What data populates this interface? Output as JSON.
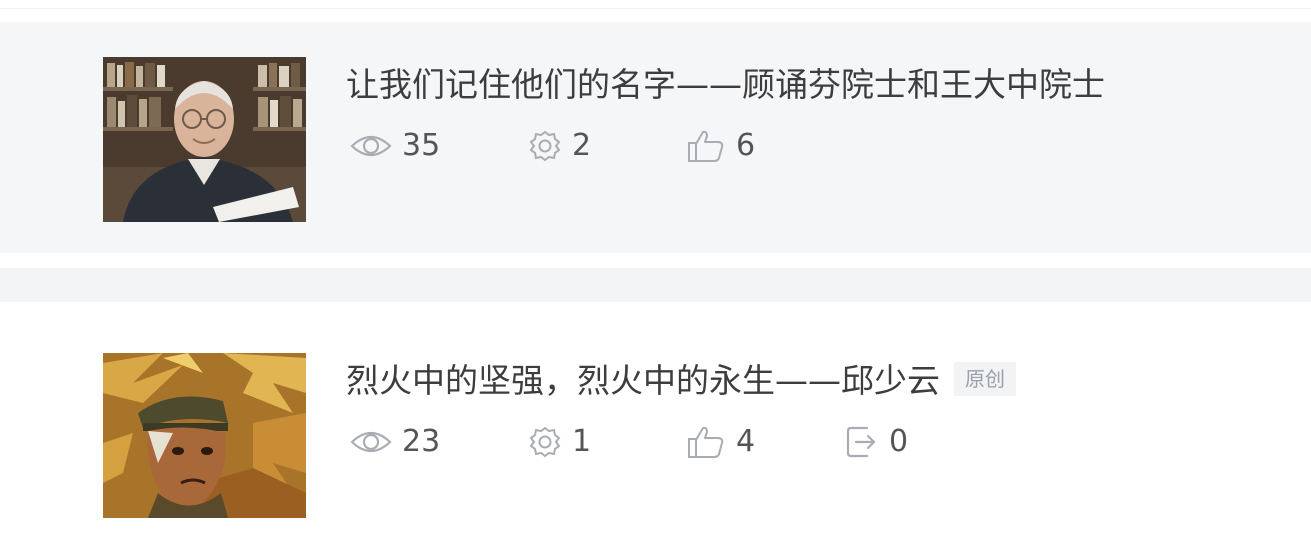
{
  "articles": [
    {
      "title": "让我们记住他们的名字——顾诵芬院士和王大中院士",
      "badge": "",
      "views": "35",
      "comments": "2",
      "likes": "6",
      "thumbnail": "portrait-elderly-man-bookshelf"
    },
    {
      "title": "烈火中的坚强，烈火中的永生——邱少云",
      "badge": "原创",
      "views": "23",
      "comments": "1",
      "likes": "4",
      "shares": "0",
      "thumbnail": "painting-soldier-in-flames"
    }
  ],
  "colors": {
    "card_bg": "#f5f6f8",
    "icon": "#a9adb3",
    "title": "#3d3d3d"
  }
}
